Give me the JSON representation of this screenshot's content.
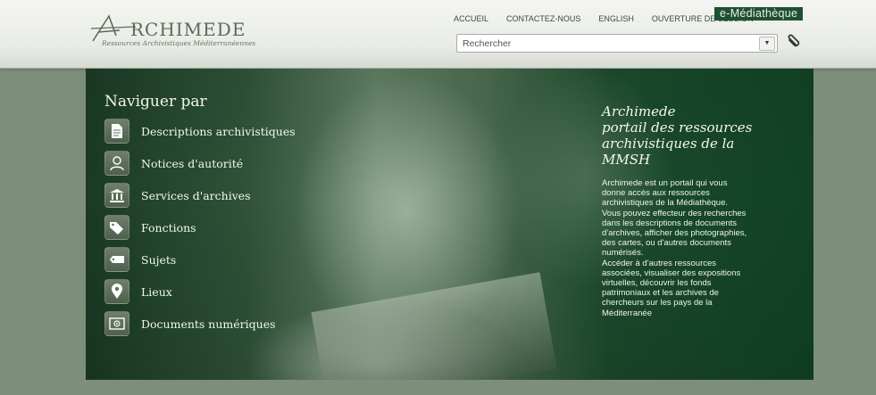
{
  "header": {
    "logo_word": "RCHIMEDE",
    "logo_sub": "Ressources Archivistiques Méditerranéennes",
    "nav": [
      "ACCUEIL",
      "CONTACTEZ-NOUS",
      "ENGLISH",
      "OUVERTURE DE SESSION"
    ],
    "emediatheque": "e-Médiathèque",
    "search_placeholder": "Rechercher",
    "icons": [
      "logo-icon",
      "dropdown-icon",
      "paperclip-icon"
    ]
  },
  "browse": {
    "title": "Naviguer par",
    "items": [
      {
        "label": "Descriptions archivistiques",
        "icon": "document-icon"
      },
      {
        "label": "Notices d'autorité",
        "icon": "person-icon"
      },
      {
        "label": "Services d'archives",
        "icon": "institution-icon"
      },
      {
        "label": "Fonctions",
        "icon": "tags-icon"
      },
      {
        "label": "Sujets",
        "icon": "tag-icon"
      },
      {
        "label": "Lieux",
        "icon": "map-pin-icon"
      },
      {
        "label": "Documents numériques",
        "icon": "image-icon"
      }
    ]
  },
  "intro": {
    "title_lines": [
      "Archimede",
      "portail des ressources",
      "archivistiques de la",
      "MMSH"
    ],
    "body_lines": [
      "Archimede est un portail qui vous",
      "donne accès aux ressources",
      "archivistiques de la Médiathèque.",
      "Vous pouvez effecteur des recherches",
      "dans les descriptions de documents",
      "d'archives, afficher des photographies,",
      "des cartes, ou d'autres documents",
      "numérisés.",
      "Accéder à d'autres ressources",
      "associées, visualiser des expositions",
      "virtuelles, découvrir les fonds",
      "patrimoniaux et les archives de",
      "chercheurs sur les pays de la",
      "Méditerranée"
    ]
  },
  "colors": {
    "brand_dark_green": "#1f5031",
    "page_bg": "#7d8f7a",
    "header_bg": "#f4f5f2"
  }
}
